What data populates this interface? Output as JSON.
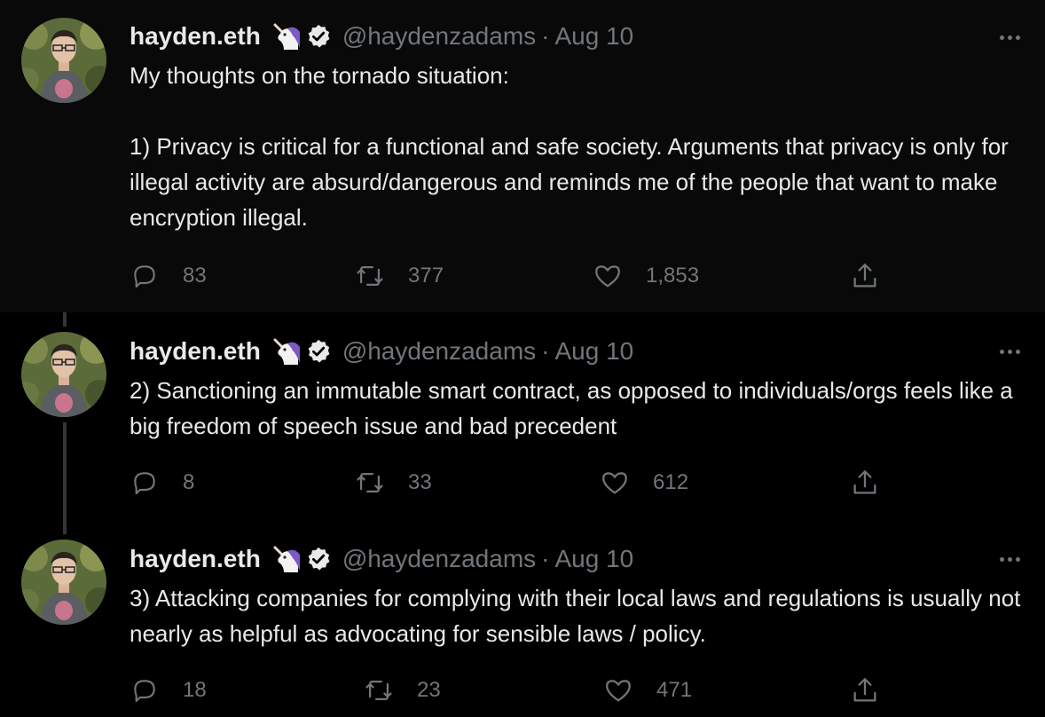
{
  "author": {
    "name": "hayden.eth",
    "emoji_icon": "unicorn-icon",
    "verified_icon": "verified-badge-icon",
    "handle": "@haydenzadams",
    "separator": "·"
  },
  "colors": {
    "background": "#000000",
    "highlight_background": "#090909",
    "text": "#e7e9ea",
    "muted": "#71767b",
    "thread_line": "#333639"
  },
  "tweets": [
    {
      "date": "Aug 10",
      "text_lines": [
        "My thoughts on the tornado situation:",
        "",
        "1) Privacy is critical for a functional and safe society. Arguments that privacy is only for illegal activity are absurd/dangerous and reminds me of the people that want to make encryption illegal."
      ],
      "replies": "83",
      "retweets": "377",
      "likes": "1,853"
    },
    {
      "date": "Aug 10",
      "text_lines": [
        "2) Sanctioning an immutable smart contract, as opposed to individuals/orgs feels like a big freedom of speech issue and bad precedent"
      ],
      "replies": "8",
      "retweets": "33",
      "likes": "612"
    },
    {
      "date": "Aug 10",
      "text_lines": [
        "3) Attacking companies for complying with their local laws and regulations is usually not nearly as helpful as advocating for sensible laws / policy."
      ],
      "replies": "18",
      "retweets": "23",
      "likes": "471"
    }
  ],
  "icons": {
    "reply": "reply-icon",
    "retweet": "retweet-icon",
    "like": "heart-icon",
    "share": "share-icon",
    "more": "more-options-icon"
  }
}
